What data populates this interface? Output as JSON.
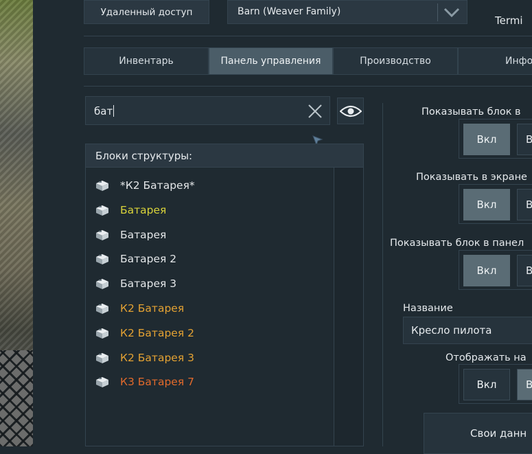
{
  "header": {
    "remote_access_label": "Удаленный доступ",
    "grid_selector_value": "Barn (Weaver Family)",
    "terminal_label": "Termi"
  },
  "tabs": [
    {
      "label": "Инвентарь",
      "active": false
    },
    {
      "label": "Панель управления",
      "active": true
    },
    {
      "label": "Производство",
      "active": false
    },
    {
      "label": "Инфо",
      "active": false
    }
  ],
  "search": {
    "value": "бат"
  },
  "blocks": {
    "heading": "Блоки структуры:",
    "items": [
      {
        "label": "*К2 Батарея*",
        "color": "#e3e6e8"
      },
      {
        "label": "Батарея",
        "color": "#d8d23a"
      },
      {
        "label": "Батарея",
        "color": "#e3e6e8"
      },
      {
        "label": "Батарея 2",
        "color": "#e3e6e8"
      },
      {
        "label": "Батарея 3",
        "color": "#e3e6e8"
      },
      {
        "label": "К2 Батарея",
        "color": "#e4a233"
      },
      {
        "label": "К2 Батарея 2",
        "color": "#e4a233"
      },
      {
        "label": "К2 Батарея 3",
        "color": "#e4a233"
      },
      {
        "label": "К3 Батарея 7",
        "color": "#e26a2c"
      }
    ]
  },
  "settings": {
    "show_block_label": "Показывать блок в",
    "show_on_screen_label": "Показывать в экране",
    "show_in_panel_label": "Показывать блок в панел",
    "name_label": "Название",
    "name_value": "Кресло пилота",
    "display_label": "Отображать на",
    "on_label": "Вкл",
    "off_label": "В",
    "custom_data_label": "Свои данн"
  },
  "colors": {
    "panel_bg": "#1f2a31",
    "active_tab": "#4b5d68",
    "active_toggle": "#5a6c75"
  }
}
